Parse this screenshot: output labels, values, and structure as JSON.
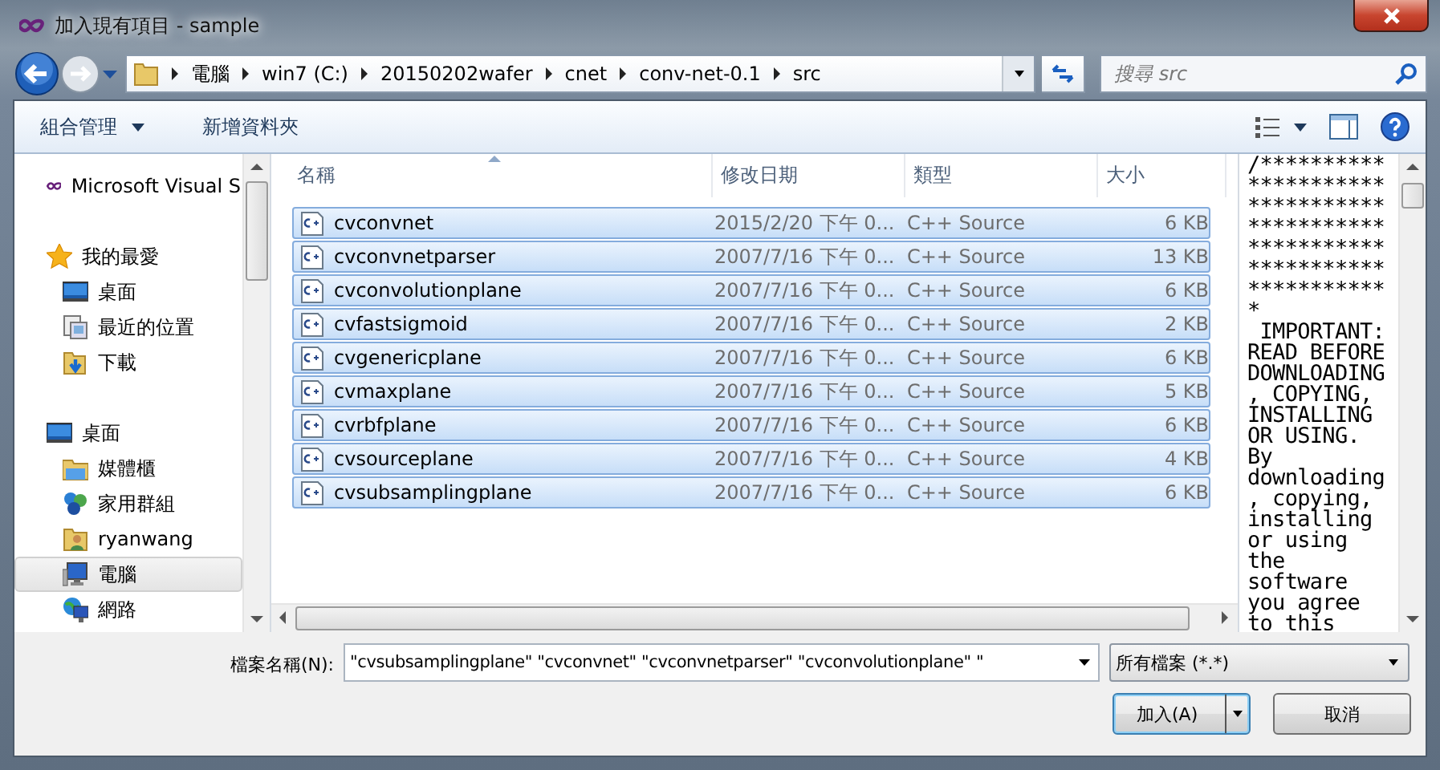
{
  "window": {
    "title": "加入現有項目 - sample"
  },
  "address_bar": {
    "crumbs": [
      "電腦",
      "win7 (C:)",
      "20150202wafer",
      "cnet",
      "conv-net-0.1",
      "src"
    ]
  },
  "search": {
    "placeholder": "搜尋 src"
  },
  "toolbar": {
    "organize": "組合管理",
    "new_folder": "新增資料夾"
  },
  "sidebar": {
    "items": [
      {
        "label": "Microsoft Visual S",
        "selected": false
      },
      {
        "label": "我的最愛",
        "selected": false,
        "children": [
          {
            "label": "桌面",
            "selected": false
          },
          {
            "label": "最近的位置",
            "selected": false
          },
          {
            "label": "下載",
            "selected": false
          }
        ]
      },
      {
        "label": "桌面",
        "selected": false,
        "children": [
          {
            "label": "媒體櫃",
            "selected": false
          },
          {
            "label": "家用群組",
            "selected": false
          },
          {
            "label": "ryanwang",
            "selected": false
          },
          {
            "label": "電腦",
            "selected": true
          },
          {
            "label": "網路",
            "selected": false
          }
        ]
      }
    ]
  },
  "file_list": {
    "columns": [
      {
        "label": "名稱",
        "sorted": true
      },
      {
        "label": "修改日期"
      },
      {
        "label": "類型"
      },
      {
        "label": "大小"
      }
    ],
    "rows": [
      {
        "name": "cvconvnet",
        "date": "2015/2/20 下午 0...",
        "type": "C++ Source",
        "size": "6 KB",
        "selected": true
      },
      {
        "name": "cvconvnetparser",
        "date": "2007/7/16 下午 0...",
        "type": "C++ Source",
        "size": "13 KB",
        "selected": true
      },
      {
        "name": "cvconvolutionplane",
        "date": "2007/7/16 下午 0...",
        "type": "C++ Source",
        "size": "6 KB",
        "selected": true
      },
      {
        "name": "cvfastsigmoid",
        "date": "2007/7/16 下午 0...",
        "type": "C++ Source",
        "size": "2 KB",
        "selected": true
      },
      {
        "name": "cvgenericplane",
        "date": "2007/7/16 下午 0...",
        "type": "C++ Source",
        "size": "6 KB",
        "selected": true
      },
      {
        "name": "cvmaxplane",
        "date": "2007/7/16 下午 0...",
        "type": "C++ Source",
        "size": "5 KB",
        "selected": true
      },
      {
        "name": "cvrbfplane",
        "date": "2007/7/16 下午 0...",
        "type": "C++ Source",
        "size": "6 KB",
        "selected": true
      },
      {
        "name": "cvsourceplane",
        "date": "2007/7/16 下午 0...",
        "type": "C++ Source",
        "size": "4 KB",
        "selected": true
      },
      {
        "name": "cvsubsamplingplane",
        "date": "2007/7/16 下午 0...",
        "type": "C++ Source",
        "size": "6 KB",
        "selected": true
      }
    ]
  },
  "preview": {
    "text": "/**********\n***********\n***********\n***********\n***********\n***********\n***********\n*\n IMPORTANT:\nREAD BEFORE\nDOWNLOADING\n, COPYING,\nINSTALLING\nOR USING.\nBy\ndownloading\n, copying,\ninstalling\nor using\nthe\nsoftware\nyou agree\nto this"
  },
  "footer": {
    "filename_label": "檔案名稱(N):",
    "filename_value": "\"cvsubsamplingplane\" \"cvconvnet\" \"cvconvnetparser\" \"cvconvolutionplane\" \"",
    "file_type": "所有檔案 (*.*)",
    "buttons": [
      "加入(A)",
      "取消"
    ]
  }
}
